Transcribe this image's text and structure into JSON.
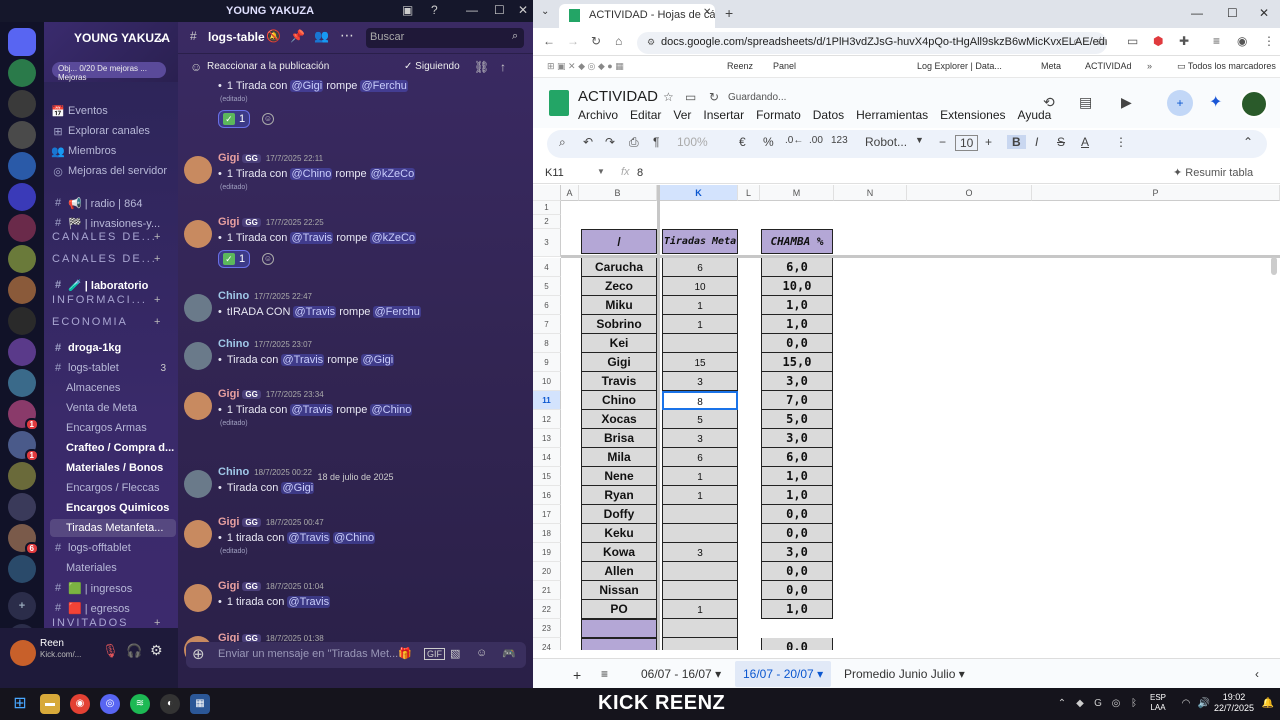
{
  "discord": {
    "window_title": "YOUNG YAKUZA",
    "server_name": "YOUNG YAKUZA",
    "boost_text": "Obj... 0/20 De mejoras ... Mejoras",
    "channels": [
      {
        "icon": "📅",
        "label": "Eventos",
        "type": "nav"
      },
      {
        "icon": "⊞",
        "label": "Explorar canales",
        "type": "nav"
      },
      {
        "icon": "👥",
        "label": "Miembros",
        "type": "nav"
      },
      {
        "icon": "◎",
        "label": "Mejoras del servidor",
        "type": "nav"
      },
      {
        "icon": "#",
        "label": "📢 | radio | 864",
        "type": "ch"
      },
      {
        "icon": "#",
        "label": "🏁 | invasiones-y...",
        "type": "ch"
      },
      {
        "icon": "#",
        "label": "🧪 | laboratorio",
        "type": "chb"
      },
      {
        "icon": "#",
        "label": "droga-1kg",
        "type": "chb"
      },
      {
        "icon": "#",
        "label": "logs-tablet",
        "type": "ch",
        "count": "3"
      },
      {
        "icon": "",
        "label": "Almacenes",
        "type": "sub"
      },
      {
        "icon": "",
        "label": "Venta de Meta",
        "type": "sub"
      },
      {
        "icon": "",
        "label": "Encargos Armas",
        "type": "sub"
      },
      {
        "icon": "",
        "label": "Crafteo / Compra d...",
        "type": "subb"
      },
      {
        "icon": "",
        "label": "Materiales / Bonos",
        "type": "subb"
      },
      {
        "icon": "",
        "label": "Encargos / Fleccas",
        "type": "sub"
      },
      {
        "icon": "",
        "label": "Encargos Quimicos",
        "type": "subb"
      },
      {
        "icon": "",
        "label": "Tiradas Metanfeta...",
        "type": "sel"
      },
      {
        "icon": "#",
        "label": "logs-offtablet",
        "type": "ch"
      },
      {
        "icon": "",
        "label": "Materiales",
        "type": "sub"
      },
      {
        "icon": "#",
        "label": "🟩 | ingresos",
        "type": "ch"
      },
      {
        "icon": "#",
        "label": "🟥 | egresos",
        "type": "ch"
      }
    ],
    "categories": [
      "CANALES DE...",
      "CANALES DE...",
      "INFORMACI...",
      "ECONOMIA",
      "INVITADOS"
    ],
    "user": {
      "name": "Reen",
      "status": "Kick.com/..."
    },
    "channel_name": "logs-table",
    "search_placeholder": "Buscar",
    "thread_action": "Reaccionar a la publicación",
    "following": "Siguiendo",
    "edited": "(editado)",
    "date_divider": "18 de julio de 2025",
    "composer_placeholder": "Enviar un mensaje en \"Tiradas Met...",
    "messages": [
      {
        "author": "",
        "time": "",
        "parts": [
          "1 Tirada con ",
          "@Gigi",
          " rompe ",
          "@Ferchu"
        ],
        "edited": true,
        "reaction": "1"
      },
      {
        "author": "Gigi",
        "tag": "GG",
        "time": "17/7/2025 22:11",
        "parts": [
          "1 Tirada con ",
          "@Chino",
          " rompe ",
          "@kZeCo"
        ],
        "edited": true
      },
      {
        "author": "Gigi",
        "tag": "GG",
        "time": "17/7/2025 22:25",
        "parts": [
          "1 Tirada con ",
          "@Travis",
          " rompe ",
          "@kZeCo"
        ],
        "edited": false,
        "reaction": "1"
      },
      {
        "author": "Chino",
        "time": "17/7/2025 22:47",
        "parts": [
          "tIRADA CON ",
          "@Travis",
          " rompe ",
          "@Ferchu"
        ]
      },
      {
        "author": "Chino",
        "time": "17/7/2025 23:07",
        "parts": [
          "Tirada con ",
          "@Travis",
          " rompe ",
          "@Gigi"
        ]
      },
      {
        "author": "Gigi",
        "tag": "GG",
        "time": "17/7/2025 23:34",
        "parts": [
          "1 Tirada con ",
          "@Travis",
          " rompe ",
          "@Chino"
        ],
        "edited": true
      },
      {
        "author": "Chino",
        "time": "18/7/2025 00:22",
        "parts": [
          "Tirada con ",
          "@Gigi",
          "",
          ""
        ]
      },
      {
        "author": "Gigi",
        "tag": "GG",
        "time": "18/7/2025 00:47",
        "parts": [
          "1 tirada con ",
          "@Travis",
          " ",
          "@Chino"
        ],
        "edited": true
      },
      {
        "author": "Gigi",
        "tag": "GG",
        "time": "18/7/2025 01:04",
        "parts": [
          "1 tirada con ",
          "@Travis",
          "",
          ""
        ]
      },
      {
        "author": "Gigi",
        "tag": "GG",
        "time": "18/7/2025 01:38",
        "parts": [
          "",
          "",
          "",
          ""
        ]
      }
    ]
  },
  "browser": {
    "tab_title": "ACTIVIDAD - Hojas de cálculo c",
    "url": "docs.google.com/spreadsheets/d/1PlH3vdZJsG-huvX4pQo-tHgAll9skzB6wMicKvxELAE/edit?gid...",
    "bookmarks": [
      "Reenz",
      "Panel",
      "Log Explorer | Data...",
      "Meta",
      "ACTIVIDAd",
      "Todos los marcadores"
    ]
  },
  "sheet": {
    "title": "ACTIVIDAD",
    "saving": "Guardando...",
    "menus": [
      "Archivo",
      "Editar",
      "Ver",
      "Insertar",
      "Formato",
      "Datos",
      "Herramientas",
      "Extensiones",
      "Ayuda"
    ],
    "zoom": "100%",
    "font": "Robot...",
    "font_size": "10",
    "num_format": "123",
    "cell_ref": "K11",
    "formula": "8",
    "summarize": "Resumir tabla",
    "col_headers": [
      "A",
      "B",
      "K",
      "L",
      "M",
      "N",
      "O",
      "P"
    ],
    "header_names": [
      "/",
      "Tiradas Meta",
      "CHAMBA %"
    ],
    "rows": [
      {
        "n": "4",
        "name": "Carucha",
        "k": "6",
        "m": "6,0"
      },
      {
        "n": "5",
        "name": "Zeco",
        "k": "10",
        "m": "10,0"
      },
      {
        "n": "6",
        "name": "Miku",
        "k": "1",
        "m": "1,0"
      },
      {
        "n": "7",
        "name": "Sobrino",
        "k": "1",
        "m": "1,0"
      },
      {
        "n": "8",
        "name": "Kei",
        "k": "",
        "m": "0,0"
      },
      {
        "n": "9",
        "name": "Gigi",
        "k": "15",
        "m": "15,0"
      },
      {
        "n": "10",
        "name": "Travis",
        "k": "3",
        "m": "3,0"
      },
      {
        "n": "11",
        "name": "Chino",
        "k": "8",
        "m": "7,0"
      },
      {
        "n": "12",
        "name": "Xocas",
        "k": "5",
        "m": "5,0"
      },
      {
        "n": "13",
        "name": "Brisa",
        "k": "3",
        "m": "3,0"
      },
      {
        "n": "14",
        "name": "Mila",
        "k": "6",
        "m": "6,0"
      },
      {
        "n": "15",
        "name": "Nene",
        "k": "1",
        "m": "1,0"
      },
      {
        "n": "16",
        "name": "Ryan",
        "k": "1",
        "m": "1,0"
      },
      {
        "n": "17",
        "name": "Doffy",
        "k": "",
        "m": "0,0"
      },
      {
        "n": "18",
        "name": "Keku",
        "k": "",
        "m": "0,0"
      },
      {
        "n": "19",
        "name": "Kowa",
        "k": "3",
        "m": "3,0"
      },
      {
        "n": "20",
        "name": "Allen",
        "k": "",
        "m": "0,0"
      },
      {
        "n": "21",
        "name": "Nissan",
        "k": "",
        "m": "0,0"
      },
      {
        "n": "22",
        "name": "PO",
        "k": "1",
        "m": "1,0"
      },
      {
        "n": "23",
        "name": "",
        "k": "",
        "m": ""
      },
      {
        "n": "24",
        "name": "",
        "k": "",
        "m": "0,0"
      }
    ],
    "tabs": [
      "06/07 - 16/07",
      "16/07 - 20/07",
      "Promedio Junio Julio"
    ]
  },
  "taskbar": {
    "overlay": "KICK REENZ",
    "lang": "ESP\nLAA",
    "time": "19:02",
    "date": "22/7/2025"
  }
}
